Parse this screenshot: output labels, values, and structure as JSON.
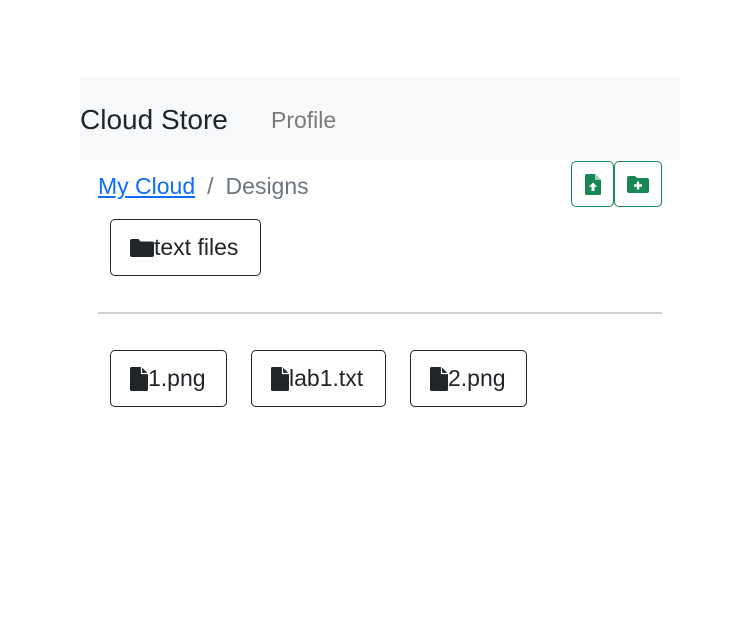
{
  "navbar": {
    "brand": "Cloud Store",
    "links": [
      "Profile"
    ]
  },
  "breadcrumb": {
    "root": "My Cloud",
    "separator": "/",
    "current": "Designs"
  },
  "actions": {
    "upload_icon": "file-upload-icon",
    "new_folder_icon": "folder-plus-icon",
    "accent_color": "#198754"
  },
  "folders": [
    {
      "name": "text files",
      "icon": "folder-icon"
    }
  ],
  "files": [
    {
      "name": "1.png",
      "icon": "file-icon"
    },
    {
      "name": "lab1.txt",
      "icon": "file-icon"
    },
    {
      "name": "2.png",
      "icon": "file-icon"
    }
  ]
}
